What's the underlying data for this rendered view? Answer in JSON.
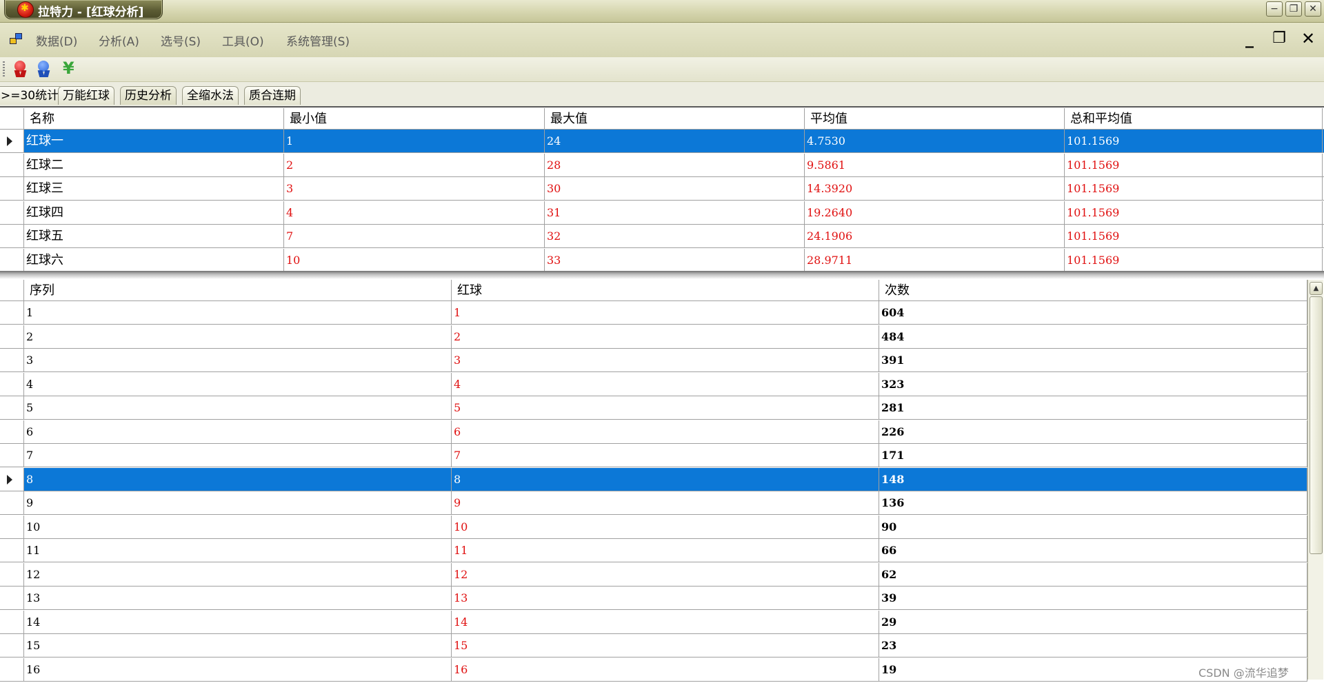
{
  "window": {
    "title": "拉特力 - [红球分析]",
    "controls": [
      "minimize",
      "restore",
      "close"
    ]
  },
  "menu": {
    "items": [
      "数据(D)",
      "分析(A)",
      "选号(S)",
      "工具(O)",
      "系统管理(S)"
    ],
    "mdi_controls": [
      "_",
      "❐",
      "✕"
    ]
  },
  "toolbar": {
    "buttons": [
      {
        "icon": "red-medal-icon",
        "color": "#e02020"
      },
      {
        "icon": "blue-medal-icon",
        "color": "#2a64d8"
      },
      {
        "icon": "yen-icon",
        "color": "#3aa63a",
        "glyph": "¥"
      }
    ]
  },
  "tabs": [
    ">=30统计",
    "万能红球",
    "历史分析",
    "全缩水法",
    "质合连期"
  ],
  "active_tab": "历史分析",
  "summary_grid": {
    "columns": [
      "名称",
      "最小值",
      "最大值",
      "平均值",
      "总和平均值"
    ],
    "selected_row": 0,
    "rows": [
      [
        "红球一",
        "1",
        "24",
        "4.7530",
        "101.1569"
      ],
      [
        "红球二",
        "2",
        "28",
        "9.5861",
        "101.1569"
      ],
      [
        "红球三",
        "3",
        "30",
        "14.3920",
        "101.1569"
      ],
      [
        "红球四",
        "4",
        "31",
        "19.2640",
        "101.1569"
      ],
      [
        "红球五",
        "7",
        "32",
        "24.1906",
        "101.1569"
      ],
      [
        "红球六",
        "10",
        "33",
        "28.9711",
        "101.1569"
      ]
    ]
  },
  "count_grid": {
    "columns": [
      "序列",
      "红球",
      "次数"
    ],
    "selected_row": 7,
    "rows": [
      [
        "1",
        "1",
        "604"
      ],
      [
        "2",
        "2",
        "484"
      ],
      [
        "3",
        "3",
        "391"
      ],
      [
        "4",
        "4",
        "323"
      ],
      [
        "5",
        "5",
        "281"
      ],
      [
        "6",
        "6",
        "226"
      ],
      [
        "7",
        "7",
        "171"
      ],
      [
        "8",
        "8",
        "148"
      ],
      [
        "9",
        "9",
        "136"
      ],
      [
        "10",
        "10",
        "90"
      ],
      [
        "11",
        "11",
        "66"
      ],
      [
        "12",
        "12",
        "62"
      ],
      [
        "13",
        "13",
        "39"
      ],
      [
        "14",
        "14",
        "29"
      ],
      [
        "15",
        "15",
        "23"
      ],
      [
        "16",
        "16",
        "19"
      ]
    ]
  },
  "watermark": "CSDN @流华追梦"
}
